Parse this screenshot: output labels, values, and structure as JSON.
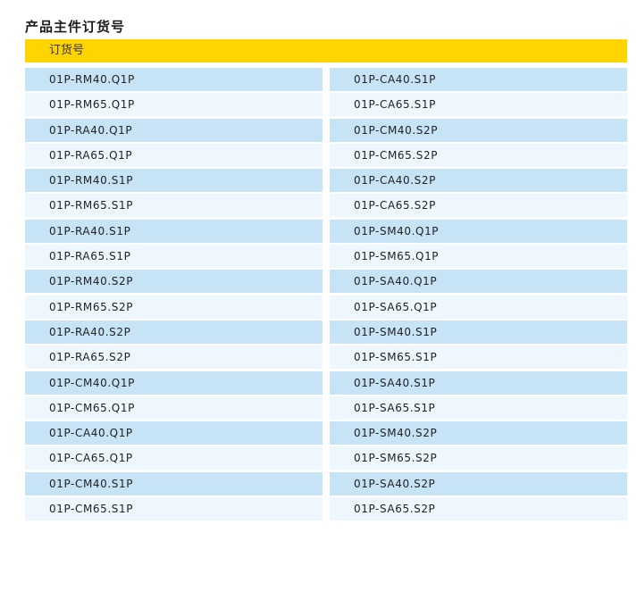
{
  "title": "产品主件订货号",
  "table": {
    "header": "订货号",
    "left": [
      "01P-RM40.Q1P",
      "01P-RM65.Q1P",
      "01P-RA40.Q1P",
      "01P-RA65.Q1P",
      "01P-RM40.S1P",
      "01P-RM65.S1P",
      "01P-RA40.S1P",
      "01P-RA65.S1P",
      "01P-RM40.S2P",
      "01P-RM65.S2P",
      "01P-RA40.S2P",
      "01P-RA65.S2P",
      "01P-CM40.Q1P",
      "01P-CM65.Q1P",
      "01P-CA40.Q1P",
      "01P-CA65.Q1P",
      "01P-CM40.S1P",
      "01P-CM65.S1P"
    ],
    "right": [
      "01P-CA40.S1P",
      "01P-CA65.S1P",
      "01P-CM40.S2P",
      "01P-CM65.S2P",
      "01P-CA40.S2P",
      "01P-CA65.S2P",
      "01P-SM40.Q1P",
      "01P-SM65.Q1P",
      "01P-SA40.Q1P",
      "01P-SA65.Q1P",
      "01P-SM40.S1P",
      "01P-SM65.S1P",
      "01P-SA40.S1P",
      "01P-SA65.S1P",
      "01P-SM40.S2P",
      "01P-SM65.S2P",
      "01P-SA40.S2P",
      "01P-SA65.S2P"
    ]
  },
  "colors": {
    "header": "#ffd400",
    "row_dark": "#c7e3f6",
    "row_light": "#eef7fd"
  }
}
